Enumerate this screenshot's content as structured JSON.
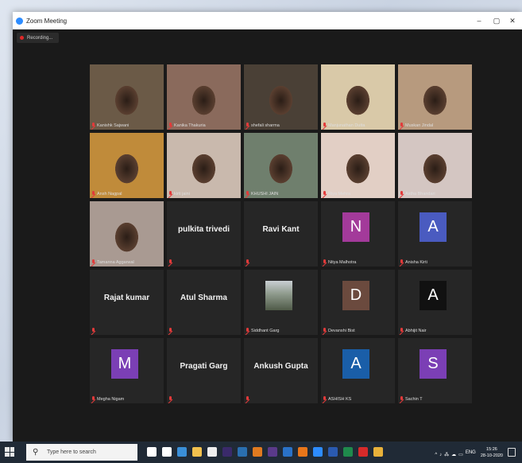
{
  "window": {
    "title": "Zoom Meeting",
    "minimize": "–",
    "maximize": "▢",
    "close": "✕"
  },
  "recording": {
    "label": "Recording..."
  },
  "participants": [
    {
      "name": "Kanishk Sajwani",
      "kind": "video",
      "active": true,
      "bg": "#6b5a47"
    },
    {
      "name": "Kanika Thakuria",
      "kind": "video",
      "bg": "#8a6a5c"
    },
    {
      "name": "shefali sharma",
      "kind": "video",
      "bg": "#4a4036"
    },
    {
      "name": "Manjunathan Dutta",
      "kind": "video",
      "bg": "#d9c9a8"
    },
    {
      "name": "Muskan Jindal",
      "kind": "video",
      "bg": "#b79a7e"
    },
    {
      "name": "Ansh Nagpal",
      "kind": "video",
      "bg": "#c08b3a"
    },
    {
      "name": "kirti jaini",
      "kind": "video",
      "bg": "#c9b9ad"
    },
    {
      "name": "KHUSHI JAIN",
      "kind": "video",
      "bg": "#6f7f6d"
    },
    {
      "name": "Riya Mehra",
      "kind": "video",
      "bg": "#e2cfc5"
    },
    {
      "name": "Astha Bhandari",
      "kind": "video",
      "bg": "#d4c6c2"
    },
    {
      "name": "Tamanna Aggarwal",
      "kind": "video",
      "bg": "#a99a92"
    },
    {
      "name": "pulkita trivedi",
      "kind": "text",
      "display": "pulkita trivedi"
    },
    {
      "name": "Ravi Kant",
      "kind": "text",
      "display": "Ravi Kant"
    },
    {
      "name": "Nitya Malhotra",
      "kind": "avatar",
      "letter": "N",
      "color": "#a33a9a"
    },
    {
      "name": "Anisha Kirti",
      "kind": "avatar",
      "letter": "A",
      "color": "#4a5bc0"
    },
    {
      "name": "Rajat kumar",
      "kind": "text",
      "display": "Rajat kumar"
    },
    {
      "name": "Atul Sharma",
      "kind": "text",
      "display": "Atul Sharma"
    },
    {
      "name": "Siddhant Garg",
      "kind": "photo",
      "color": "#7a8a78"
    },
    {
      "name": "Devanshi Bist",
      "kind": "avatar",
      "letter": "D",
      "color": "#6b4a3e"
    },
    {
      "name": "Abhijit Nair",
      "kind": "avatar",
      "letter": "A",
      "color": "#111111"
    },
    {
      "name": "Megha Nigam",
      "kind": "avatar",
      "letter": "M",
      "color": "#7b3fb5"
    },
    {
      "name": "Pragati Garg",
      "kind": "text",
      "display": "Pragati Garg"
    },
    {
      "name": "Ankush Gupta",
      "kind": "text",
      "display": "Ankush Gupta"
    },
    {
      "name": "ASHISH KS",
      "kind": "avatar",
      "letter": "A",
      "color": "#1a5ea8"
    },
    {
      "name": "Sachin T",
      "kind": "avatar",
      "letter": "S",
      "color": "#7b3fb5"
    }
  ],
  "taskbar": {
    "search_placeholder": "Type here to search",
    "icons": [
      {
        "name": "cortana-icon",
        "color": "#ffffff"
      },
      {
        "name": "task-view-icon",
        "color": "#ffffff"
      },
      {
        "name": "edge-icon",
        "color": "#3a8fd8"
      },
      {
        "name": "file-explorer-icon",
        "color": "#f2c14e"
      },
      {
        "name": "store-icon",
        "color": "#eeeeee"
      },
      {
        "name": "after-effects-icon",
        "color": "#3a2a6a"
      },
      {
        "name": "photoshop-icon",
        "color": "#2a6fb0"
      },
      {
        "name": "illustrator-icon",
        "color": "#e07a20"
      },
      {
        "name": "premiere-icon",
        "color": "#5a3a8a"
      },
      {
        "name": "mail-icon",
        "color": "#2a72c8"
      },
      {
        "name": "firefox-icon",
        "color": "#e8761a"
      },
      {
        "name": "zoom-icon",
        "color": "#2d8cff"
      },
      {
        "name": "word-icon",
        "color": "#2a5ab0"
      },
      {
        "name": "excel-icon",
        "color": "#1f8a4c"
      },
      {
        "name": "acrobat-icon",
        "color": "#d62a2a"
      },
      {
        "name": "chrome-icon",
        "color": "#e8b13a"
      }
    ],
    "tray_symbols": [
      "^",
      "♪",
      "⁂",
      "☁",
      "▭"
    ],
    "language": "ENG",
    "time": "15:26",
    "date": "28-10-2020"
  }
}
